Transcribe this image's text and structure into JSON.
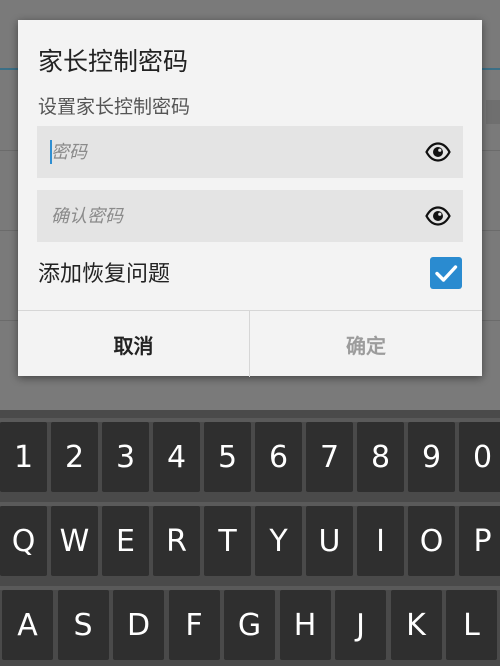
{
  "dialog": {
    "title": "家长控制密码",
    "subtitle": "设置家长控制密码",
    "password_placeholder": "密码",
    "confirm_placeholder": "确认密码",
    "recovery_label": "添加恢复问题",
    "recovery_checked": true,
    "cancel_label": "取消",
    "ok_label": "确定"
  },
  "keyboard": {
    "number_row": [
      "1",
      "2",
      "3",
      "4",
      "5",
      "6",
      "7",
      "8",
      "9",
      "0"
    ],
    "row_q": [
      "Q",
      "W",
      "E",
      "R",
      "T",
      "Y",
      "U",
      "I",
      "O",
      "P"
    ],
    "row_a": [
      "A",
      "S",
      "D",
      "F",
      "G",
      "H",
      "J",
      "K",
      "L"
    ]
  },
  "colors": {
    "accent": "#2a8bd0",
    "key_bg": "#2f2f2f",
    "keyboard_bg": "#4a4a4a"
  }
}
